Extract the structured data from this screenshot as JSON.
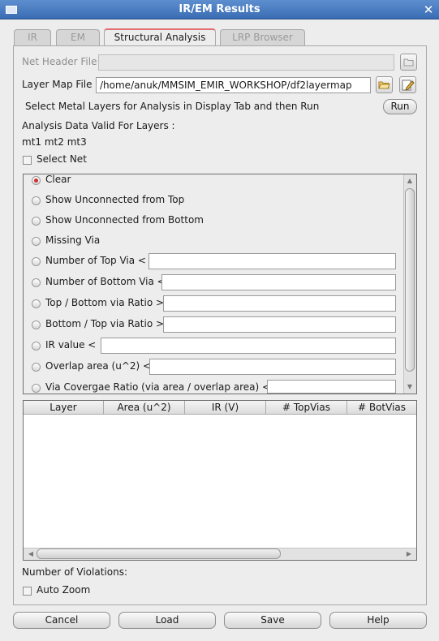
{
  "window": {
    "title": "IR/EM Results"
  },
  "tabs": [
    "IR",
    "EM",
    "Structural Analysis",
    "LRP Browser"
  ],
  "net_header": {
    "label": "Net Header File",
    "value": ""
  },
  "layer_map": {
    "label": "Layer Map File",
    "value": "/home/anuk/MMSIM_EMIR_WORKSHOP/df2layermap"
  },
  "instruction": "Select Metal Layers for Analysis in Display Tab and then Run",
  "run_label": "Run",
  "analysis_valid_label": "Analysis Data Valid For Layers :",
  "layers_text": "mt1  mt2  mt3",
  "select_net_label": "Select Net",
  "options": [
    {
      "label": "Clear",
      "selected": true
    },
    {
      "label": "Show Unconnected from Top",
      "selected": false
    },
    {
      "label": "Show Unconnected from Bottom",
      "selected": false
    },
    {
      "label": "Missing Via",
      "selected": false
    },
    {
      "label": "Number of Top Via <",
      "selected": false
    },
    {
      "label": "Number of Bottom Via <",
      "selected": false
    },
    {
      "label": "Top / Bottom via Ratio >",
      "selected": false
    },
    {
      "label": "Bottom / Top via Ratio >",
      "selected": false
    },
    {
      "label": "IR value <",
      "selected": false
    },
    {
      "label": "Overlap area (u^2) <",
      "selected": false
    },
    {
      "label": "Via Covergae Ratio (via area / overlap area) <",
      "selected": false
    }
  ],
  "table": {
    "columns": [
      "Layer",
      "Area (u^2)",
      "IR (V)",
      "# TopVias",
      "# BotVias"
    ],
    "rows": []
  },
  "violations_label": "Number of Violations:",
  "auto_zoom_label": "Auto Zoom",
  "buttons": {
    "cancel": "Cancel",
    "load": "Load",
    "save": "Save",
    "help": "Help"
  },
  "colors": {
    "titlebar": "#3a6cb4",
    "active_tab_accent": "#e07070",
    "selected_radio": "#d03030"
  },
  "icons": {
    "net_header_browse": "folder-icon",
    "layer_map_browse": "folder-open-icon",
    "layer_map_edit": "edit-icon",
    "close": "close-icon"
  }
}
